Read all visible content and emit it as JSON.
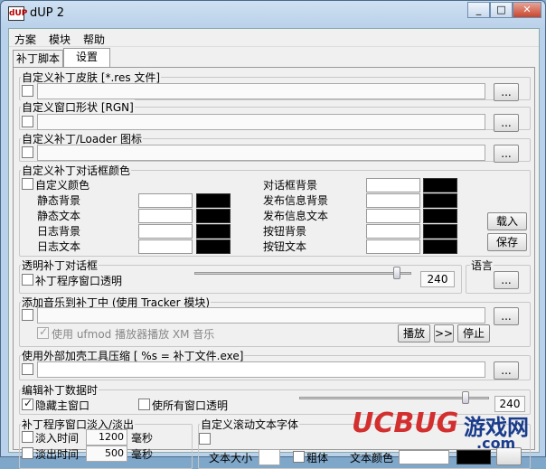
{
  "window": {
    "title": "dUP 2",
    "app_icon_text": "dUP"
  },
  "menu": [
    "方案",
    "模块",
    "帮助"
  ],
  "tabs": [
    "补丁脚本",
    "设置"
  ],
  "groups": {
    "skin": {
      "label": "自定义补丁皮肤 [*.res 文件]",
      "browse": "..."
    },
    "shape": {
      "label": "自定义窗口形状 [RGN]",
      "browse": "..."
    },
    "icon": {
      "label": "自定义补丁/Loader 图标",
      "browse": "..."
    },
    "colors": {
      "label": "自定义补丁对话框颜色",
      "custom_color": "自定义颜色",
      "left": [
        "静态背景",
        "静态文本",
        "日志背景",
        "日志文本"
      ],
      "right": [
        "对话框背景",
        "发布信息背景",
        "发布信息文本",
        "按钮背景",
        "按钮文本"
      ],
      "load": "载入",
      "save": "保存"
    },
    "transparent": {
      "label": "透明补丁对话框",
      "check": "补丁程序窗口透明",
      "value": "240"
    },
    "language": {
      "label": "语言",
      "browse": "..."
    },
    "music": {
      "label": "添加音乐到补丁中 (使用 Tracker 模块)",
      "use_ufmod": "使用 ufmod 播放器播放 XM 音乐",
      "play": "播放",
      "next": ">>",
      "stop": "停止",
      "browse": "..."
    },
    "packer": {
      "label": "使用外部加壳工具压缩 [ %s = 补丁文件.exe]",
      "browse": "..."
    },
    "edit": {
      "label": "编辑补丁数据时",
      "hide_main": "隐藏主窗口",
      "all_transparent": "使所有窗口透明",
      "value": "240"
    },
    "fade": {
      "label": "补丁程序窗口淡入/淡出",
      "fade_in": "淡入时间",
      "fade_in_val": "1200",
      "fade_out": "淡出时间",
      "fade_out_val": "500",
      "unit": "毫秒"
    },
    "scroll": {
      "label": "自定义滚动文本字体",
      "size": "文本大小",
      "bold": "粗体",
      "color": "文本颜色"
    }
  },
  "watermark": {
    "text": "UCBUG",
    "cn": "游戏网",
    "domain": ".com"
  },
  "colors": {
    "accent": "#c8462e",
    "watermark_red": "#d32f2f",
    "watermark_blue": "#1a3c8c"
  }
}
